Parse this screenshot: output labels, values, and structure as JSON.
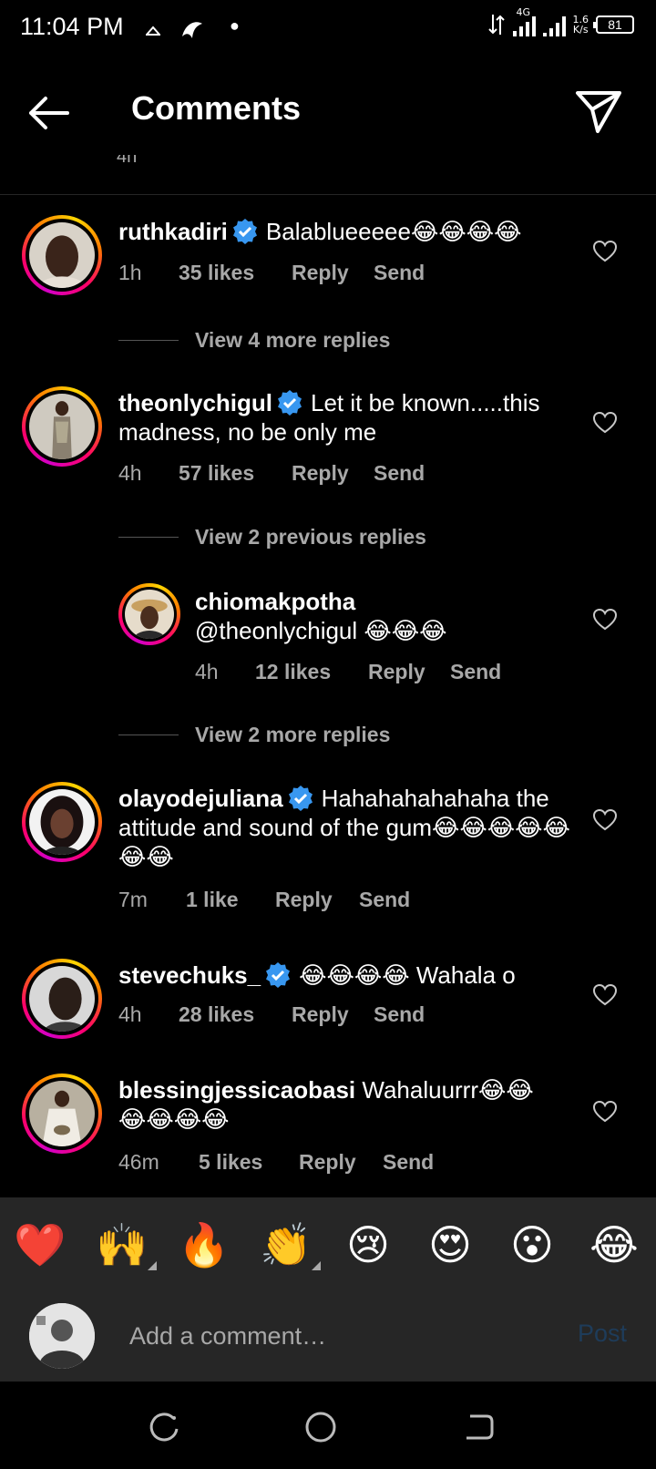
{
  "status_bar": {
    "time": "11:04 PM",
    "network_type": "4G",
    "speed_value": "1.6",
    "speed_unit": "K/s",
    "battery": "81"
  },
  "header": {
    "title": "Comments",
    "back_icon": "arrow-left-icon",
    "send_icon": "paper-plane-icon"
  },
  "partial_timestamp": "4h",
  "comments": [
    {
      "username": "ruthkadiri",
      "verified": true,
      "text": "Balablueeeee😂😂😂😂",
      "time": "1h",
      "likes": "35 likes",
      "reply": "Reply",
      "send": "Send",
      "view_replies": "View 4 more replies"
    },
    {
      "username": "theonlychigul",
      "verified": true,
      "text": "Let it be known.....this madness, no be only me",
      "time": "4h",
      "likes": "57 likes",
      "reply": "Reply",
      "send": "Send",
      "view_previous": "View 2 previous replies",
      "reply_item": {
        "username": "chiomakpotha",
        "text": "@theonlychigul 😂😂😂",
        "time": "4h",
        "likes": "12 likes",
        "reply": "Reply",
        "send": "Send"
      },
      "view_replies": "View 2 more replies"
    },
    {
      "username": "olayodejuliana",
      "verified": true,
      "text": "Hahahahahahaha  the attitude and sound of the gum😂😂😂😂😂😂😂",
      "time": "7m",
      "likes": "1 like",
      "reply": "Reply",
      "send": "Send"
    },
    {
      "username": "stevechuks_",
      "verified": true,
      "text": "😂😂😂😂 Wahala o",
      "time": "4h",
      "likes": "28 likes",
      "reply": "Reply",
      "send": "Send"
    },
    {
      "username": "blessingjessicaobasi",
      "verified": false,
      "text": "Wahaluurrr😂😂😂😂😂😂",
      "time": "46m",
      "likes": "5 likes",
      "reply": "Reply",
      "send": "Send"
    }
  ],
  "emoji_bar": [
    "❤️",
    "🙌",
    "🔥",
    "👏",
    "😢",
    "😍",
    "😮",
    "😂"
  ],
  "comment_input": {
    "placeholder": "Add a comment…",
    "post_label": "Post"
  },
  "colors": {
    "background": "#000000",
    "muted_text": "#a8a8a8",
    "verified_blue": "#3897f0",
    "post_disabled": "#1e3c5a",
    "bar_bg": "#262626"
  }
}
